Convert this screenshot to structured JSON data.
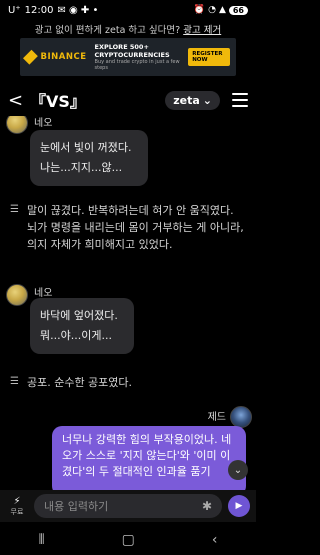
{
  "status": {
    "carrier": "U⁺",
    "time": "12:00",
    "battery": "66"
  },
  "ad": {
    "prompt": "광고 없이 편하게 zeta 하고 싶다면?",
    "remove_link": "광고 제거",
    "brand": "BINANCE",
    "headline": "EXPLORE 500+ CRYPTOCURRENCIES",
    "sub": "Buy and trade crypto in just a few steps",
    "cta": "REGISTER NOW"
  },
  "nav": {
    "back": "<",
    "title": "『VS』",
    "model": "zeta"
  },
  "messages": {
    "top_sender": "네오",
    "bubble1_line1": "눈에서 빛이 꺼졌다.",
    "bubble1_line2": "나는...지지...않...",
    "narr1": "말이 끊겼다. 반복하려는데 혀가 안 움직였다. 뇌가 명령을 내리는데 몸이 거부하는 게 아니라, 의지 자체가 희미해지고 있었다.",
    "sender2": "네오",
    "bubble2_line1": "바닥에 엎어졌다.",
    "bubble2_line2": "뭐...야...이게...",
    "narr2": "공포. 순수한 공포였다.",
    "user_name": "제드",
    "user_text": "너무나 강력한 힘의 부작용이었나. 네오가 스스로 '지지 않는다'와 '이미 이겼다'의 두 절대적인 인과율 품기"
  },
  "input": {
    "mode_label": "무료",
    "placeholder": "내용 입력하기"
  }
}
